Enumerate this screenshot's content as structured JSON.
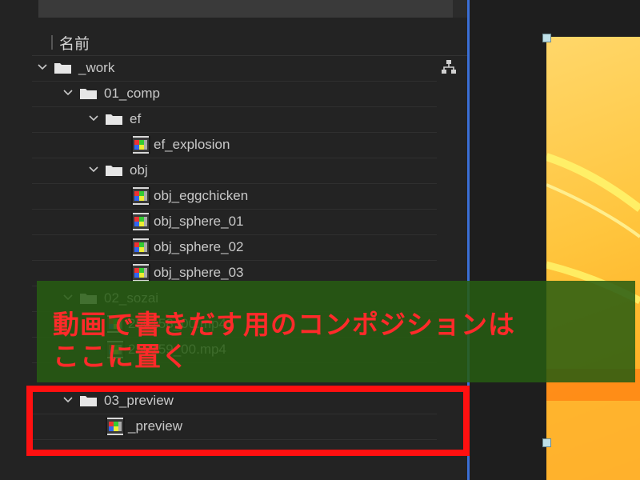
{
  "panel": {
    "header_label": "名前"
  },
  "tree": [
    {
      "name": "_work",
      "type": "folder",
      "depth": 0,
      "expanded": true
    },
    {
      "name": "01_comp",
      "type": "folder",
      "depth": 1,
      "expanded": true
    },
    {
      "name": "ef",
      "type": "folder",
      "depth": 2,
      "expanded": true
    },
    {
      "name": "ef_explosion",
      "type": "comp",
      "depth": 3
    },
    {
      "name": "obj",
      "type": "folder",
      "depth": 2,
      "expanded": true
    },
    {
      "name": "obj_eggchicken",
      "type": "comp",
      "depth": 3
    },
    {
      "name": "obj_sphere_01",
      "type": "comp",
      "depth": 3
    },
    {
      "name": "obj_sphere_02",
      "type": "comp",
      "depth": 3
    },
    {
      "name": "obj_sphere_03",
      "type": "comp",
      "depth": 3
    },
    {
      "name": "02_sozai",
      "type": "folder",
      "depth": 1,
      "expanded": true
    },
    {
      "name": "250158_00.mp4",
      "type": "footage",
      "depth": 2
    },
    {
      "name": "250159_00.mp4",
      "type": "footage",
      "depth": 2
    },
    {
      "name": "03_preview",
      "type": "folder",
      "depth": 1,
      "expanded": true
    },
    {
      "name": "_preview",
      "type": "comp",
      "depth": 2
    }
  ],
  "annotation": {
    "line1": "動画で書きだす用のコンポジションは",
    "line2": "ここに置く"
  },
  "colors": {
    "highlight": "#ff1010",
    "annotation_text": "#ff2a2a",
    "overlay": "#265c12",
    "panel_divider": "#3b6fd6"
  },
  "icons": [
    "chevron-down-icon",
    "folder-icon",
    "composition-icon",
    "flowchart-icon"
  ]
}
